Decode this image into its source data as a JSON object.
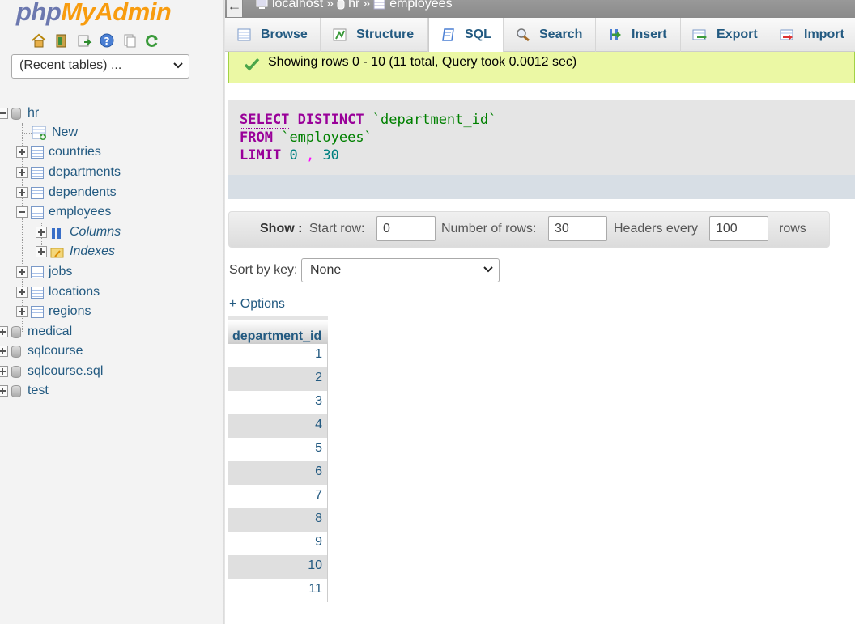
{
  "sidebar": {
    "logo_php": "php",
    "logo_myadmin": "MyAdmin",
    "navi_icons": [
      "home-icon",
      "exit-icon",
      "sql-query-icon",
      "docs-icon",
      "settings-icon",
      "reload-icon"
    ],
    "recent_tables": "(Recent tables) ...",
    "tree": {
      "db_hr": "hr",
      "new": "New",
      "tables": [
        "countries",
        "departments",
        "dependents",
        "employees"
      ],
      "columns": "Columns",
      "indexes": "Indexes",
      "tables_after": [
        "jobs",
        "locations",
        "regions"
      ],
      "other_dbs": [
        "medical",
        "sqlcourse",
        "sqlcourse.sql",
        "test"
      ]
    }
  },
  "breadcrumb": {
    "back": "←",
    "server": "localhost",
    "sep": "»",
    "database": "hr",
    "table": "employees"
  },
  "tabs": [
    "Browse",
    "Structure",
    "SQL",
    "Search",
    "Insert",
    "Export",
    "Import"
  ],
  "active_tab": "SQL",
  "success_message": "Showing rows 0 - 10 (11 total, Query took 0.0012 sec)",
  "sql": {
    "kw_select": "SELECT",
    "kw_distinct": "DISTINCT",
    "col": "`department_id`",
    "kw_from": "FROM",
    "tbl": "`employees`",
    "kw_limit": "LIMIT",
    "offset": "0",
    "comma": ",",
    "count": "30"
  },
  "navigation": {
    "show_label": "Show :",
    "start_row_label": "Start row:",
    "start_row_value": "0",
    "num_rows_label": "Number of rows:",
    "num_rows_value": "30",
    "headers_every_label": "Headers every",
    "headers_every_value": "100",
    "rows_label": "rows"
  },
  "sort": {
    "label": "Sort by key:",
    "value": "None"
  },
  "options_link": "+ Options",
  "results": {
    "column": "department_id",
    "rows": [
      "1",
      "2",
      "3",
      "4",
      "5",
      "6",
      "7",
      "8",
      "9",
      "10",
      "11"
    ]
  },
  "colors": {
    "link": "#235a81",
    "success_bg": "#ebf8a4",
    "sql_keyword": "#990099",
    "logo_php": "#6c78af",
    "logo_myadmin": "#f89c0e"
  }
}
